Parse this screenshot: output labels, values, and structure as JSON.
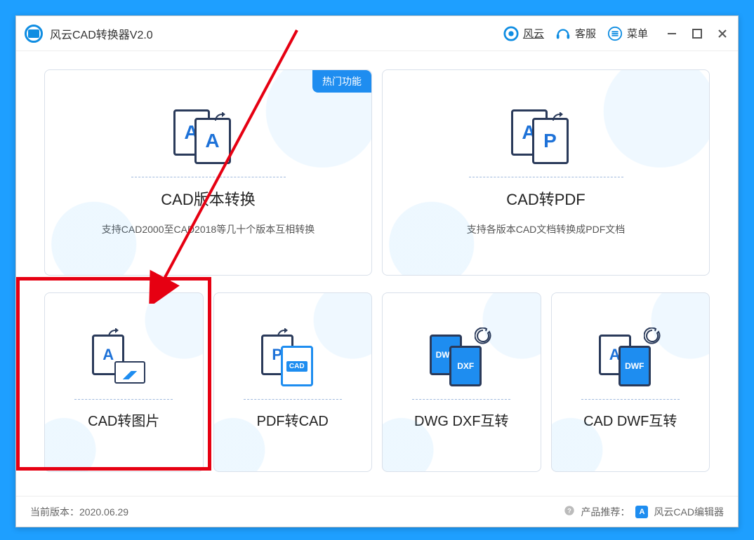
{
  "titlebar": {
    "app_title": "风云CAD转换器V2.0",
    "brand": "风云",
    "help": "客服",
    "menu": "菜单"
  },
  "badges": {
    "hot": "热门功能"
  },
  "cards": {
    "version": {
      "title": "CAD版本转换",
      "subtitle": "支持CAD2000至CAD2018等几十个版本互相转换"
    },
    "pdf": {
      "title": "CAD转PDF",
      "subtitle": "支持各版本CAD文档转换成PDF文档"
    },
    "image": {
      "title": "CAD转图片"
    },
    "pdf2cad": {
      "title": "PDF转CAD"
    },
    "dwgdxf": {
      "title": "DWG DXF互转"
    },
    "caddwf": {
      "title": "CAD DWF互转"
    }
  },
  "footer": {
    "version_label": "当前版本：",
    "version_value": "2020.06.29",
    "recommend_label": "产品推荐：",
    "recommend_product": "风云CAD编辑器"
  },
  "icons": {
    "letter_a": "A",
    "letter_p": "P",
    "dwg": "DWG",
    "dxf": "DXF",
    "dwf": "DWF",
    "cad": "CAD"
  }
}
